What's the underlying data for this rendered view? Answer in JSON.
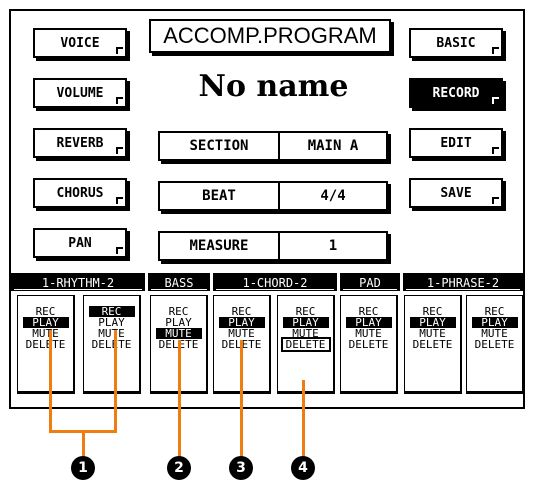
{
  "left_buttons": [
    {
      "label": "VOICE"
    },
    {
      "label": "VOLUME"
    },
    {
      "label": "REVERB"
    },
    {
      "label": "CHORUS"
    },
    {
      "label": "PAN"
    }
  ],
  "right_buttons": [
    {
      "label": "BASIC",
      "selected": false
    },
    {
      "label": "RECORD",
      "selected": true
    },
    {
      "label": "EDIT",
      "selected": false
    },
    {
      "label": "SAVE",
      "selected": false
    }
  ],
  "screen_title": "ACCOMP.PROGRAM",
  "song_name": "No name",
  "fields": [
    {
      "label": "SECTION",
      "value": "MAIN A"
    },
    {
      "label": "BEAT",
      "value": "4/4"
    },
    {
      "label": "MEASURE",
      "value": "1"
    }
  ],
  "track_groups": [
    "1-RHYTHM-2",
    "BASS",
    "1-CHORD-2",
    "PAD",
    "1-PHRASE-2"
  ],
  "track_columns": [
    {
      "rec": "REC",
      "play": "PLAY",
      "mute": "MUTE",
      "delete": "DELETE",
      "selected": "play"
    },
    {
      "rec": "REC",
      "play": "PLAY",
      "mute": "MUTE",
      "delete": "DELETE",
      "selected": "rec"
    },
    {
      "rec": "REC",
      "play": "PLAY",
      "mute": "MUTE",
      "delete": "DELETE",
      "selected": "mute"
    },
    {
      "rec": "REC",
      "play": "PLAY",
      "mute": "MUTE",
      "delete": "DELETE",
      "selected": "play"
    },
    {
      "rec": "REC",
      "play": "PLAY",
      "mute": "MUTE",
      "delete": "DELETE",
      "selected": "play"
    },
    {
      "rec": "REC",
      "play": "PLAY",
      "mute": "MUTE",
      "delete": "DELETE",
      "selected": "play"
    },
    {
      "rec": "REC",
      "play": "PLAY",
      "mute": "MUTE",
      "delete": "DELETE",
      "selected": "play"
    },
    {
      "rec": "REC",
      "play": "PLAY",
      "mute": "MUTE",
      "delete": "DELETE",
      "selected": "play"
    }
  ],
  "callouts": [
    "1",
    "2",
    "3",
    "4"
  ],
  "colors": {
    "callout_line": "#f07d10",
    "screen_bg": "#ffffff",
    "ink": "#000000"
  }
}
